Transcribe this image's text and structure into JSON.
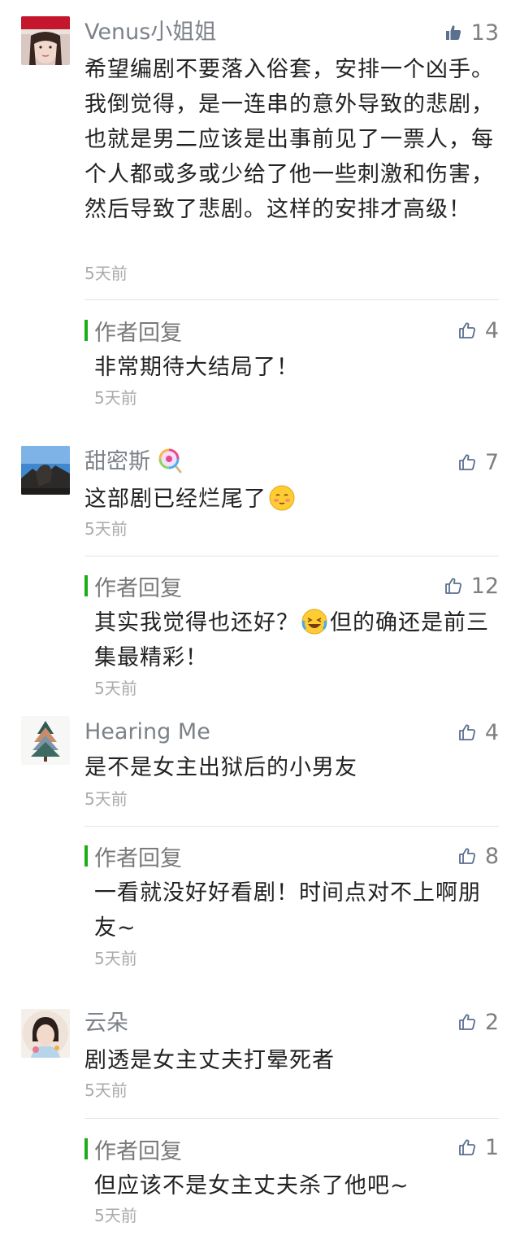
{
  "comments": [
    {
      "name": "Venus小姐姐",
      "likes": "13",
      "text": "希望编剧不要落入俗套，安排一个凶手。我倒觉得，是一连串的意外导致的悲剧，也就是男二应该是出事前见了一票人，每个人都或多或少给了他一些刺激和伤害，然后导致了悲剧。这样的安排才高级！",
      "time": "5天前",
      "reply": {
        "label": "作者回复",
        "likes": "4",
        "text": "非常期待大结局了！",
        "time": "5天前"
      }
    },
    {
      "name": "甜密斯",
      "name_icon": "lollipop-icon",
      "likes": "7",
      "text": "这部剧已经烂尾了",
      "text_icon": "blushing-face-icon",
      "time": "5天前",
      "reply": {
        "label": "作者回复",
        "likes": "12",
        "text_a": "其实我觉得也还好？",
        "text_icon": "laughing-crying-face-icon",
        "text_b": "但的确还是前三集最精彩！",
        "time": "5天前"
      }
    },
    {
      "name": "Hearing Me",
      "likes": "4",
      "text": "是不是女主出狱后的小男友",
      "time": "5天前",
      "reply": {
        "label": "作者回复",
        "likes": "8",
        "text": "一看就没好好看剧！时间点对不上啊朋友~",
        "time": "5天前"
      }
    },
    {
      "name": "云朵",
      "likes": "2",
      "text": "剧透是女主丈夫打晕死者",
      "time": "5天前",
      "reply": {
        "label": "作者回复",
        "likes": "1",
        "text": "但应该不是女主丈夫杀了他吧~",
        "time": "5天前"
      }
    }
  ],
  "colors": {
    "reply_bar": "#1aad19",
    "name": "#7c8288",
    "text": "#222222",
    "time": "#aaaaaa"
  }
}
